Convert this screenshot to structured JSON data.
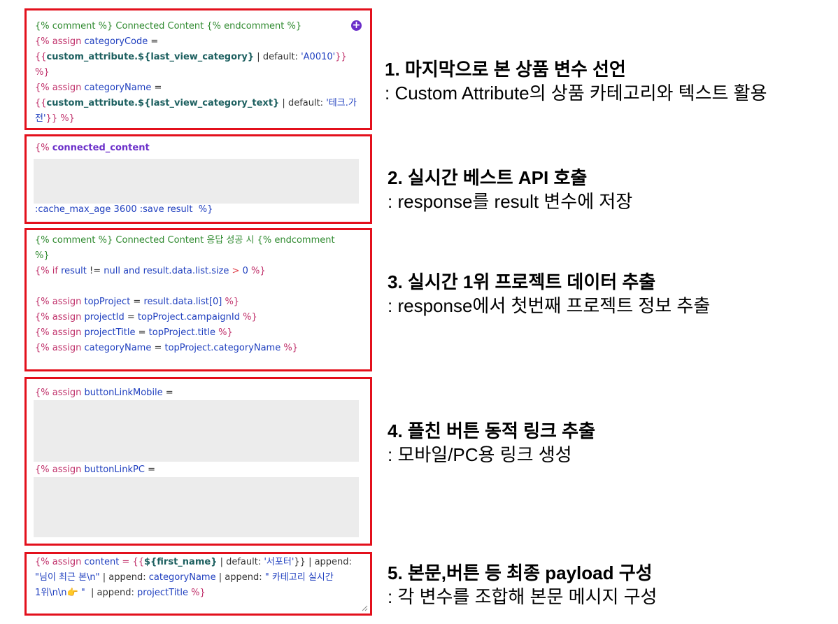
{
  "blocks": [
    {
      "lines": {
        "l1a": "{% comment %} Connected Content {% endcomment %}",
        "l2a": "{% assign ",
        "l2b": "categoryCode",
        "l2c": " =",
        "l3a": "{{",
        "l3b": "custom_attribute.${last_view_category}",
        "l3c": " | default: ",
        "l3d": "'A0010'",
        "l3e": "}} %}",
        "l4a": "{% assign ",
        "l4b": "categoryName",
        "l4c": " =",
        "l5a": "{{",
        "l5b": "custom_attribute.${last_view_category_text}",
        "l5c": " | default: ",
        "l5d": "'테크.가",
        "l6a": "전'",
        "l6b": "}} %}"
      },
      "add_icon": "plus-circle-icon",
      "title": "1. 마지막으로 본 상품 변수 선언",
      "subtitle": ": Custom Attribute의 상품 카테고리와 텍스트 활용"
    },
    {
      "lines": {
        "l1a": "{% ",
        "l1b": "connected_content",
        "l2a": ":cache_max_age 3600 :save result  %}"
      },
      "title": "2. 실시간 베스트 API 호출",
      "subtitle": ": response를 result 변수에 저장"
    },
    {
      "lines": {
        "l1a": "{% comment %} Connected Content 응답 성공 시 {% endcomment",
        "l2a": "%}",
        "l3a": "{% if ",
        "l3b": "result",
        "l3c": " != ",
        "l3d": "null and result.data.list.size",
        "l3e": " > ",
        "l3f": "0",
        "l3g": " %}",
        "l4a": "{% assign ",
        "l4b": "topProject",
        "l4c": " = ",
        "l4d": "result.data.list[0]",
        "l4e": " %}",
        "l5a": "{% assign ",
        "l5b": "projectId",
        "l5c": " = ",
        "l5d": "topProject.campaignId",
        "l5e": " %}",
        "l6a": "{% assign ",
        "l6b": "projectTitle",
        "l6c": " = ",
        "l6d": "topProject.title",
        "l6e": " %}",
        "l7a": "{% assign ",
        "l7b": "categoryName",
        "l7c": " = ",
        "l7d": "topProject.categoryName",
        "l7e": " %}"
      },
      "title": "3. 실시간 1위 프로젝트 데이터 추출",
      "subtitle": ": response에서 첫번째 프로젝트 정보 추출"
    },
    {
      "lines": {
        "l1a": "{% assign ",
        "l1b": "buttonLinkMobile",
        "l1c": " =",
        "l2a": "{% assign ",
        "l2b": "buttonLinkPC",
        "l2c": " ="
      },
      "title": "4. 플친 버튼 동적 링크 추출",
      "subtitle": ": 모바일/PC용 링크 생성"
    },
    {
      "lines": {
        "l1a": "{% assign ",
        "l1b": "content",
        "l1c": " = {{",
        "l1d": "${first_name}",
        "l1e": " | default: ",
        "l1f": "'서포터'",
        "l1g": "}} | append:",
        "l2a": "\"님이 최근 본\\n\"",
        "l2b": " | append: ",
        "l2c": "categoryName",
        "l2d": " | append: ",
        "l2e": "\" 카테고리 실시간",
        "l3a": "1위\\n\\n👉 \"",
        "l3b": "  | append: ",
        "l3c": "projectTitle",
        "l3d": " %}"
      },
      "resize_icon": "resize-grip-icon",
      "title": "5. 본문,버튼 등 최종 payload 구성",
      "subtitle": ": 각 변수를 조합해 본문 메시지 구성"
    }
  ],
  "colors": {
    "border": "#e3101c",
    "accent": "#6b2fc9",
    "placeholder": "#ececec"
  }
}
